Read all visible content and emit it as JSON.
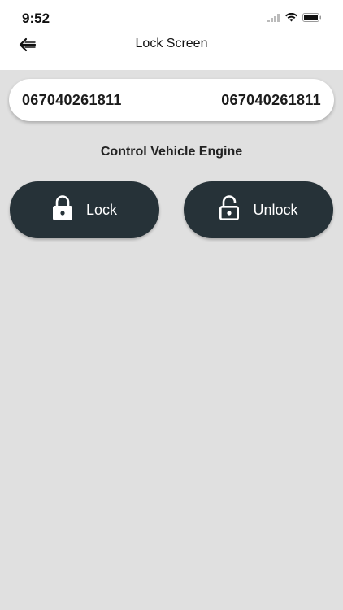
{
  "status_bar": {
    "time": "9:52",
    "icons": [
      "signal-icon",
      "wifi-icon",
      "battery-icon"
    ]
  },
  "app_bar": {
    "title": "Lock Screen",
    "back_icon": "back-arrow-icon"
  },
  "vehicle": {
    "id_left": "067040261811",
    "id_right": "067040261811"
  },
  "control": {
    "title": "Control Vehicle Engine",
    "lock_label": "Lock",
    "unlock_label": "Unlock",
    "lock_icon": "lock-closed-icon",
    "unlock_icon": "lock-open-icon"
  },
  "colors": {
    "background": "#e0e0e0",
    "button": "#263238",
    "card": "#ffffff"
  }
}
